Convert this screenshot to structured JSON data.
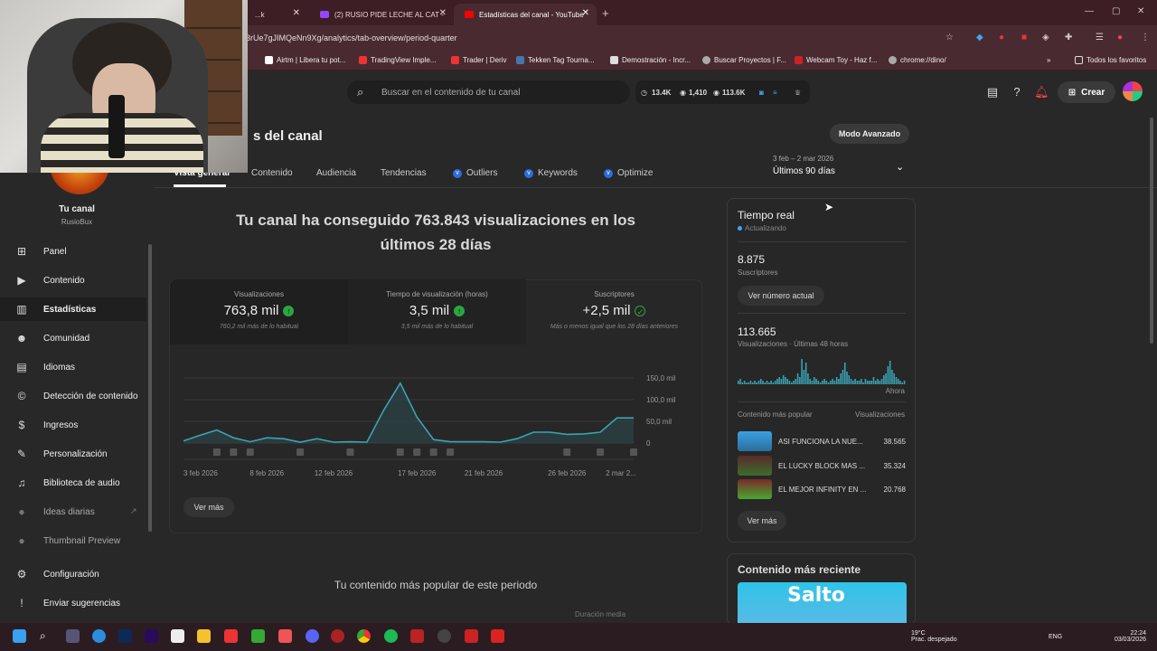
{
  "browser": {
    "tabs": [
      {
        "title": "...k",
        "active": false
      },
      {
        "title": "(2) RUSIO PIDE LECHE AL CAT -",
        "active": false
      },
      {
        "title": "Estadísticas del canal - YouTube",
        "active": true
      }
    ],
    "url": "3rUe7gJIMQeNn9Xg/analytics/tab-overview/period-quarter",
    "bookmarks": [
      "Airtm | Libera tu pot...",
      "TradingView Imple...",
      "Trader | Deriv",
      "Tekken Tag Tourna...",
      "Demostración - Incr...",
      "Buscar Proyectos | F...",
      "Webcam Toy - Haz f...",
      "chrome://dino/"
    ],
    "bookmarks_folder": "Todos los favoritos"
  },
  "header": {
    "search_placeholder": "Buscar en el contenido de tu canal",
    "stat_subs": "13.4K",
    "stat_videos": "1,410",
    "stat_views": "113.6K",
    "create_label": "Crear"
  },
  "sidebar": {
    "channel_name": "Tu canal",
    "channel_handle": "RusioBux",
    "items": [
      {
        "label": "Panel",
        "icon": "dashboard-icon"
      },
      {
        "label": "Contenido",
        "icon": "content-icon"
      },
      {
        "label": "Estadísticas",
        "icon": "analytics-icon"
      },
      {
        "label": "Comunidad",
        "icon": "community-icon"
      },
      {
        "label": "Idiomas",
        "icon": "subtitles-icon"
      },
      {
        "label": "Detección de contenido",
        "icon": "copyright-icon"
      },
      {
        "label": "Ingresos",
        "icon": "earn-icon"
      },
      {
        "label": "Personalización",
        "icon": "customization-icon"
      },
      {
        "label": "Biblioteca de audio",
        "icon": "audio-library-icon"
      },
      {
        "label": "Ideas diarias",
        "icon": "ideas-icon"
      },
      {
        "label": "Thumbnail Preview",
        "icon": "thumbnail-icon"
      },
      {
        "label": "Configuración",
        "icon": "settings-icon"
      },
      {
        "label": "Enviar sugerencias",
        "icon": "feedback-icon"
      }
    ]
  },
  "page": {
    "title": "s del canal",
    "advanced_button": "Modo Avanzado",
    "tabs": [
      "Vista general",
      "Contenido",
      "Audiencia",
      "Tendencias",
      "Outliers",
      "Keywords",
      "Optimize"
    ],
    "date_range_sub": "3 feb – 2 mar 2026",
    "date_range": "Últimos 90 días",
    "headline": "Tu canal ha conseguido 763.843 visualizaciones en los últimos 28 días",
    "metrics": [
      {
        "label": "Visualizaciones",
        "value": "763,8 mil",
        "sub": "760,2 mil más de lo habitual"
      },
      {
        "label": "Tiempo de visualización (horas)",
        "value": "3,5 mil",
        "sub": "3,5 mil más de lo habitual"
      },
      {
        "label": "Suscriptores",
        "value": "+2,5 mil",
        "sub": "Más o menos igual que los 28 días anteriores"
      }
    ],
    "see_more": "Ver más",
    "popular_title": "Tu contenido más popular de este periodo",
    "duration_label": "Duración media"
  },
  "chart_data": {
    "type": "area",
    "x": [
      "3 feb 2026",
      "4 feb",
      "5 feb",
      "6 feb",
      "7 feb",
      "8 feb 2026",
      "9 feb",
      "10 feb",
      "11 feb",
      "12 feb 2026",
      "13 feb",
      "14 feb",
      "15 feb",
      "16 feb",
      "17 feb 2026",
      "18 feb",
      "19 feb",
      "20 feb",
      "21 feb 2026",
      "22 feb",
      "23 feb",
      "24 feb",
      "25 feb",
      "26 feb 2026",
      "27 feb",
      "28 feb",
      "1 mar",
      "2 mar 2026"
    ],
    "x_tick_labels": [
      "3 feb 2026",
      "8 feb 2026",
      "12 feb 2026",
      "17 feb 2026",
      "21 feb 2026",
      "26 feb 2026",
      "2 mar 2..."
    ],
    "values": [
      5,
      18,
      30,
      12,
      3,
      12,
      10,
      2,
      10,
      2,
      3,
      2,
      75,
      138,
      60,
      8,
      3,
      3,
      3,
      2,
      10,
      25,
      25,
      20,
      21,
      25,
      58,
      58
    ],
    "y_tick_labels": [
      "150,0 mil",
      "100,0 mil",
      "50,0 mil",
      "0"
    ],
    "ylim": [
      0,
      150
    ],
    "color": "#3aa3b5"
  },
  "realtime": {
    "title": "Tiempo real",
    "status": "Actualizando",
    "subs_value": "8.875",
    "subs_label": "Suscriptores",
    "see_count_button": "Ver número actual",
    "views_value": "113.665",
    "views_label": "Visualizaciones · Últimas 48 horas",
    "now_label": "Ahora",
    "popular_label": "Contenido más popular",
    "views_col": "Visualizaciones",
    "top": [
      {
        "title": "ASI FUNCIONA LA NUE...",
        "views": "38.565"
      },
      {
        "title": "EL LUCKY BLOCK MAS ...",
        "views": "35.324"
      },
      {
        "title": "EL MEJOR INFINITY EN ...",
        "views": "20.768"
      }
    ],
    "see_more": "Ver más",
    "bars": [
      2,
      3,
      1,
      2,
      1,
      1,
      2,
      1,
      2,
      1,
      2,
      3,
      2,
      1,
      2,
      1,
      2,
      1,
      2,
      3,
      4,
      3,
      5,
      4,
      3,
      2,
      1,
      2,
      3,
      6,
      4,
      14,
      8,
      12,
      6,
      3,
      2,
      4,
      3,
      2,
      1,
      2,
      3,
      2,
      1,
      2,
      3,
      2,
      4,
      3,
      6,
      8,
      12,
      7,
      5,
      3,
      2,
      3,
      2,
      2,
      3,
      1,
      3,
      2,
      2,
      2,
      4,
      2,
      3,
      2,
      3,
      5,
      6,
      10,
      13,
      8,
      6,
      4,
      3,
      2,
      1,
      2
    ]
  },
  "recent": {
    "title": "Contenido más reciente",
    "thumb_text": "Salto"
  },
  "taskbar": {
    "weather": "19°C",
    "weather_sub": "Prac. despejado",
    "lang": "ENG",
    "time": "22:24",
    "date": "03/03/2026"
  }
}
